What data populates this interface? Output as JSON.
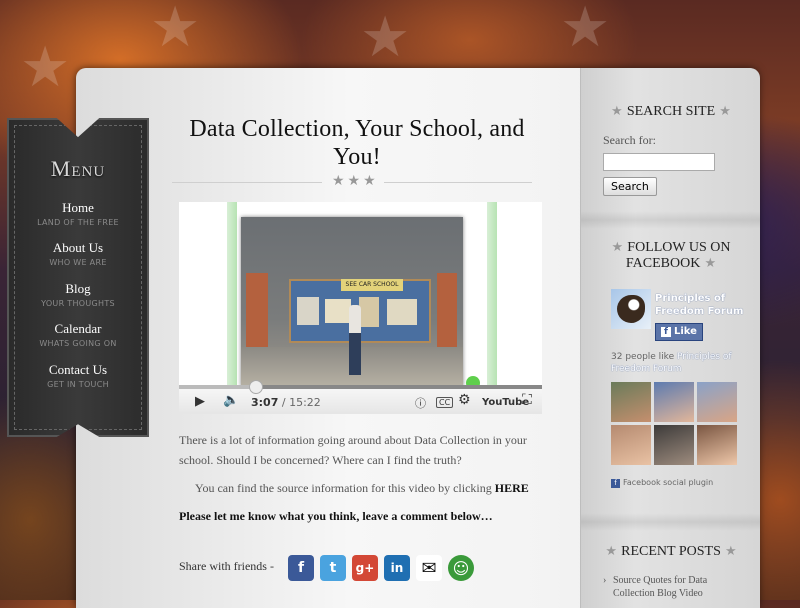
{
  "post": {
    "title": "Data Collection, Your School, and You!",
    "paragraph1": "There is a lot of information going around about Data Collection in your school.  Should I be concerned?  Where can I find the truth?",
    "paragraph2_prefix": "You can find the source information for this video by clicking ",
    "paragraph2_link": "HERE",
    "paragraph3": "Please let me know what you think, leave a comment below…"
  },
  "video": {
    "time_current": "3:07",
    "time_total": "/ 15:22",
    "board_text": "SEE CAR SCHOOL",
    "progress": 0.21,
    "youtube_label": "YouTube",
    "cc_label": "CC"
  },
  "share": {
    "label": "Share with friends -",
    "icons": [
      {
        "name": "facebook",
        "glyph": "f",
        "color": "#3b5998"
      },
      {
        "name": "twitter",
        "glyph": "t",
        "color": "#4aa3df"
      },
      {
        "name": "google-plus",
        "glyph": "g+",
        "color": "#d34836"
      },
      {
        "name": "linkedin",
        "glyph": "in",
        "color": "#1f6fb2"
      },
      {
        "name": "email",
        "glyph": "✉",
        "color": "#ffffff"
      },
      {
        "name": "share",
        "glyph": "☺",
        "color": "#3a9a3a"
      }
    ]
  },
  "menu": {
    "title": "Menu",
    "items": [
      {
        "label": "Home",
        "sub": "LAND OF THE FREE"
      },
      {
        "label": "About Us",
        "sub": "WHO WE ARE"
      },
      {
        "label": "Blog",
        "sub": "YOUR THOUGHTS"
      },
      {
        "label": "Calendar",
        "sub": "WHATS GOING ON"
      },
      {
        "label": "Contact Us",
        "sub": "GET IN TOUCH"
      }
    ]
  },
  "sidebar": {
    "search": {
      "heading": "SEARCH SITE",
      "label": "Search for:",
      "value": "",
      "button": "Search"
    },
    "facebook": {
      "heading": "FOLLOW US ON FACEBOOK",
      "page_name": "Principles of Freedom Forum",
      "like_button": "Like",
      "likes_prefix": "32 people like ",
      "likes_link": "Principles of Freedom Forum",
      "plugin_label": "Facebook social plugin"
    },
    "recent": {
      "heading": "RECENT POSTS",
      "items": [
        "Source Quotes for Data Collection Blog Video"
      ]
    }
  },
  "colors": {
    "accent_link": "#111111",
    "facebook_blue": "#3b5998"
  }
}
